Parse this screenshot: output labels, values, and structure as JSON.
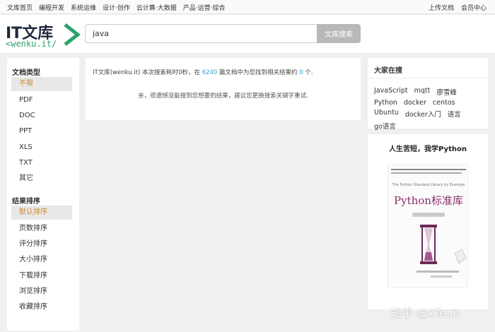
{
  "topnav": {
    "left": [
      "文库首页",
      "编程开发",
      "系统运维",
      "设计·创作",
      "云计算·大数据",
      "产品·运营·综合"
    ],
    "right": [
      "上传文档",
      "会员中心"
    ]
  },
  "logo": {
    "brand": "IT文库",
    "domain": "<wenku.it/"
  },
  "search": {
    "value": "java",
    "button_label": "文库搜索"
  },
  "sidebar": {
    "doc_type_title": "文档类型",
    "doc_types": [
      "不限",
      "PDF",
      "DOC",
      "PPT",
      "XLS",
      "TXT",
      "其它"
    ],
    "doc_type_selected": "不限",
    "sort_title": "结果排序",
    "sorts": [
      "默认排序",
      "页数排序",
      "评分排序",
      "大小排序",
      "下载排序",
      "浏览排序",
      "收藏排序"
    ],
    "sort_selected": "默认排序"
  },
  "results": {
    "summary_prefix": "IT文库(wenku.it) 本次搜索耗时",
    "time": "0",
    "summary_mid1": "秒，在",
    "doc_count": "6240",
    "summary_mid2": "篇文档中为您找到相关结果约",
    "result_count": "0",
    "summary_suffix": "个.",
    "no_result": "亲，很遗憾没能搜到您想要的结果，建议您更换搜索关键字重试."
  },
  "hot": {
    "title": "大家在搜",
    "tags": [
      "JavaScript",
      "mqtt",
      "廖雪峰",
      "Python",
      "docker",
      "centos",
      "Ubuntu",
      "docker入门",
      "语言",
      "go语言"
    ]
  },
  "ad": {
    "title": "人生苦短，我学Python",
    "book_subtitle": "The Python Standard Library by Example",
    "book_title": "Python标准库"
  },
  "watermark": "知乎 @xTech",
  "colors": {
    "accent_selected": "#d08a2e",
    "number_link": "#3a9fc1",
    "logo_green": "#2aa36b"
  }
}
